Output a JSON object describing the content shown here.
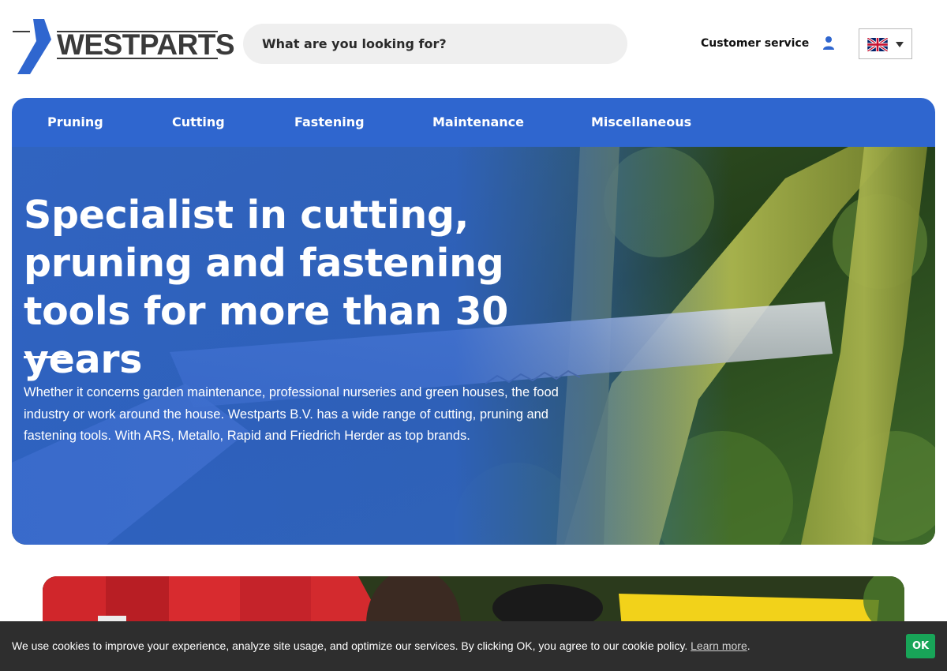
{
  "brand": {
    "name": "WESTPARTS",
    "primary_color": "#2f66cf",
    "logo_color": "#2f66cf",
    "text_color": "#3a3a3a"
  },
  "header": {
    "search_placeholder": "What are you looking for?",
    "customer_service": "Customer service",
    "user_icon": "user-icon",
    "language_icon": "uk-flag-icon",
    "language_caret_icon": "caret-down-icon"
  },
  "nav": {
    "items": [
      {
        "label": "Pruning"
      },
      {
        "label": "Cutting"
      },
      {
        "label": "Fastening"
      },
      {
        "label": "Maintenance"
      },
      {
        "label": "Miscellaneous"
      }
    ]
  },
  "hero": {
    "title": "Specialist in cutting, pruning and fastening tools for more than 30 years",
    "text": "Whether it concerns garden maintenance, professional nurseries and green houses, the food industry or work around the house. Westparts B.V. has a wide range of cutting, pruning and fastening tools. With ARS, Metallo, Rapid and Friedrich Herder as top brands."
  },
  "cookie": {
    "message": "We use cookies to improve your experience, analyze site usage, and optimize our services. By clicking OK, you agree to our cookie policy.",
    "link_label": "Learn more",
    "period": ".",
    "ok_label": "OK",
    "ok_color": "#18a558"
  }
}
